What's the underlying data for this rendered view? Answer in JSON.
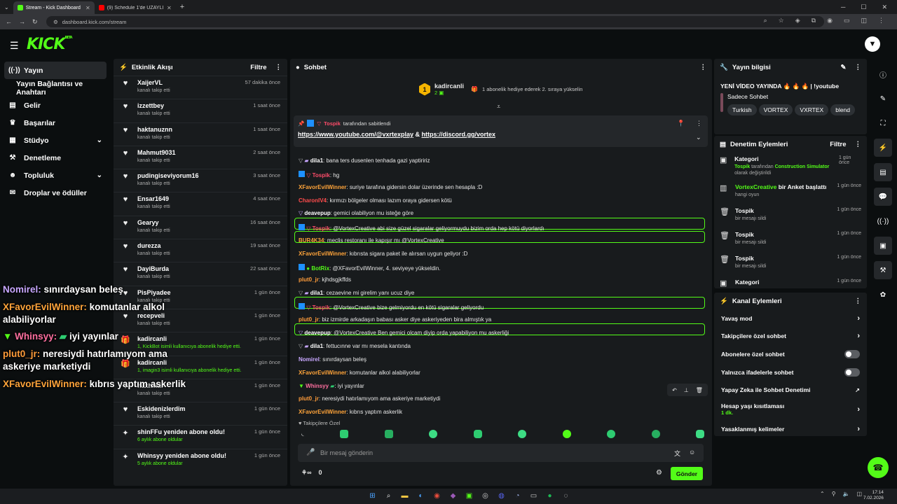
{
  "browser": {
    "tabs": [
      {
        "title": "Stream - Kick Dashboard",
        "color": "#53fc18"
      },
      {
        "title": "(9) Schedule 1'de UZAYLI İSTİLA",
        "color": "#ff0000"
      }
    ],
    "new_tab": "+",
    "url": "dashboard.kick.com/stream"
  },
  "logo": {
    "text": "KICK",
    "badge": "BETA"
  },
  "sidebar": {
    "items": [
      {
        "label": "Yayın",
        "icon": "((·))"
      },
      {
        "label": "Yayın Bağlantısı ve Anahtarı",
        "icon": ""
      },
      {
        "label": "Gelir",
        "icon": "▤"
      },
      {
        "label": "Başarılar",
        "icon": "🏆"
      },
      {
        "label": "Stüdyo",
        "icon": "▦"
      },
      {
        "label": "Denetleme",
        "icon": "🔧"
      },
      {
        "label": "Topluluk",
        "icon": "👥"
      },
      {
        "label": "Droplar ve ödüller",
        "icon": "🎁"
      }
    ]
  },
  "overlay_chat": [
    {
      "user": "Nomirel:",
      "text": " sınırdaysan beleş",
      "color": "#c8a7ff"
    },
    {
      "user": "XFavorEvilWinner:",
      "text": " komutanlar alkol alabiliyorlar",
      "color": "#ffa43a"
    },
    {
      "user": "Whinsyy:",
      "text": " iyi yayınlar",
      "color": "#ff6fa0"
    },
    {
      "user": "plut0_jr:",
      "text": " neresiydi hatırlamıyom ama askeriye marketiydi",
      "color": "#ff9c3a"
    },
    {
      "user": "XFavorEvilWinner:",
      "text": " kıbrıs yaptım askerlik",
      "color": "#ffa43a"
    }
  ],
  "activity": {
    "title": "Etkinlik Akışı",
    "filter": "Filtre",
    "items": [
      {
        "name": "XaijerVL",
        "desc": "kanalı takip etti",
        "time": "57 dakika önce"
      },
      {
        "name": "izzettbey",
        "desc": "kanalı takip etti",
        "time": "1 saat önce"
      },
      {
        "name": "haktanuznn",
        "desc": "kanalı takip etti",
        "time": "1 saat önce"
      },
      {
        "name": "Mahmut9031",
        "desc": "kanalı takip etti",
        "time": "2 saat önce"
      },
      {
        "name": "pudingiseviyorum16",
        "desc": "kanalı takip etti",
        "time": "3 saat önce"
      },
      {
        "name": "Ensar1649",
        "desc": "kanalı takip etti",
        "time": "4 saat önce"
      },
      {
        "name": "Gearyy",
        "desc": "kanalı takip etti",
        "time": "16 saat önce"
      },
      {
        "name": "durezza",
        "desc": "kanalı takip etti",
        "time": "19 saat önce"
      },
      {
        "name": "DayiBurda",
        "desc": "kanalı takip etti",
        "time": "22 saat önce"
      },
      {
        "name": "PisPiyadee",
        "desc": "kanalı takip etti",
        "time": "1 gün önce"
      },
      {
        "name": "recepveli",
        "desc": "kanalı takip etti",
        "time": "1 gün önce"
      },
      {
        "name": "kadircanli",
        "desc": "1, KickBot isimli kullanıcıya abonelik hediye etti.",
        "time": "1 gün önce"
      },
      {
        "name": "kadircanli",
        "desc": "1, imagin3 isimli kullanıcıya abonelik hediye etti.",
        "time": "1 gün önce"
      },
      {
        "name": "haxhiktir",
        "desc": "kanalı takip etti",
        "time": "1 gün önce"
      },
      {
        "name": "Eskidenizlerdim",
        "desc": "kanalı takip etti",
        "time": "1 gün önce"
      },
      {
        "name": "shinFFu yeniden abone oldu!",
        "desc": "6 aylık abone oldular",
        "time": "1 gün önce"
      },
      {
        "name": "Whinsyy yeniden abone oldu!",
        "desc": "5 aylık abone oldular",
        "time": "1 gün önce"
      }
    ]
  },
  "chat": {
    "title": "Sohbet",
    "top_user": "kadircanli",
    "top_user_count": "2",
    "top_msg": "1 abonelik hediye ederek 2. sıraya yükselin",
    "pinned_by": "Tospik",
    "pinned_suffix": " tarafından sabitlendi",
    "pinned_link1": "https://www.youtube.com/@vxrtexplay",
    "pinned_amp": " & ",
    "pinned_link2": "https://discord.gg/vortex",
    "messages": [
      {
        "user": "dila1",
        "text": ": bana ters dusenlen tenhada gazi yaptiririz",
        "color": "#ffffff"
      },
      {
        "user": "Tospik",
        "text": ": hg",
        "color": "#ff4c6a"
      },
      {
        "user": "XFavorEvilWinner",
        "text": ": suriye tarafına gidersin dolar üzerinde sen hesapla :D",
        "color": "#ffa43a"
      },
      {
        "user": "CharonIV4",
        "text": ": kırmızı bölgeler olması lazım oraya gidersen kötü",
        "color": "#ff4c4c"
      },
      {
        "user": "deavepup",
        "text": ": gemici olabiliyon mu isteğe göre",
        "color": "#ffffff"
      },
      {
        "user": "Tospik",
        "text": ": @VortexCreative abi size güzel sigaralar geliyormuydu bizim orda hep kötü diyorlardı",
        "color": "#ff4c6a"
      },
      {
        "user": "BUR4K34",
        "text": ": meclis restoranı ile kapışır mı @VortexCreative",
        "color": "#ffa43a"
      },
      {
        "user": "XFavorEvilWinner",
        "text": ": kıbrısta sigara paket ile alırsan uygun geliyor :D",
        "color": "#ffa43a"
      },
      {
        "user": "BotRix",
        "text": ": @XFavorEvilWinner, 4. seviyeye yükseldin.",
        "color": "#53fc18"
      },
      {
        "user": "plut0_jr",
        "text": ": kjhdsgjkffds",
        "color": "#ff9c3a"
      },
      {
        "user": "dila1",
        "text": ": cezaevine mi girelim yanı ucuz diye",
        "color": "#ffffff"
      },
      {
        "user": "Tospik",
        "text": ": @VortexCreative bize gelmiyordu en kötü sigaralar geliyordu",
        "color": "#ff4c6a"
      },
      {
        "user": "plut0_jr",
        "text": ": biz izmirde arkadaşın babası asker diye askeriyeden bira almıştık ya",
        "color": "#ff9c3a"
      },
      {
        "user": "deavepup",
        "text": ": @VortexCreative Ben gemici olcam diyip orda yapabiliyon mu askerliği",
        "color": "#ffffff"
      },
      {
        "user": "dila1",
        "text": ": fettucınne var mı mesela kantında",
        "color": "#ffffff"
      },
      {
        "user": "Nomirel",
        "text": ": sınırdaysan beleş",
        "color": "#c8a7ff"
      },
      {
        "user": "XFavorEvilWinner",
        "text": ": komutanlar alkol alabiliyorlar",
        "color": "#ffa43a"
      },
      {
        "user": "Whinsyy",
        "text": ": iyi yayınlar",
        "color": "#ff6fa0"
      },
      {
        "user": "plut0_jr",
        "text": ": neresiydi hatırlamıyom ama askeriye marketiydi",
        "color": "#ff9c3a"
      },
      {
        "user": "XFavorEvilWinner",
        "text": ": kıbrıs yaptım askerlik",
        "color": "#ffa43a"
      }
    ],
    "followers_only": "Takipçilere Özel",
    "input_placeholder": "Bir mesaj gönderin",
    "points": "0",
    "send": "Gönder"
  },
  "stream_info": {
    "title": "Yayın bilgisi",
    "stream_title": "YENİ VİDEO YAYINDA 🔥 🔥 🔥 | !youtube",
    "category": "Sadece Sohbet",
    "tags": [
      "Turkish",
      "VORTEX",
      "VXRTEX",
      "blend"
    ]
  },
  "mod_actions": {
    "title": "Denetim Eylemleri",
    "filter": "Filtre",
    "items": [
      {
        "name": "Kategori",
        "desc_user": "Tospik",
        "desc_mid": " tarafından ",
        "desc_cat": "Construction Simulator",
        "desc_end": " olarak değiştirildi",
        "time": "1 gün önce"
      },
      {
        "name": "VortexCreative",
        "name_suffix": " bir Anket başlattı",
        "desc": "hangi oyun",
        "time": "1 gün önce"
      },
      {
        "name": "Tospik",
        "desc": "bir mesajı sildi",
        "time": "1 gün önce"
      },
      {
        "name": "Tospik",
        "desc": "bir mesajı sildi",
        "time": "1 gün önce"
      },
      {
        "name": "Tospik",
        "desc": "bir mesajı sildi",
        "time": "1 gün önce"
      },
      {
        "name": "Kategori",
        "desc": "",
        "time": "1 gün önce"
      }
    ]
  },
  "channel_actions": {
    "title": "Kanal Eylemleri",
    "items": [
      {
        "label": "Yavaş mod",
        "type": "chevron"
      },
      {
        "label": "Takipçilere özel sohbet",
        "type": "chevron"
      },
      {
        "label": "Abonelere özel sohbet",
        "type": "toggle"
      },
      {
        "label": "Yalnızca ifadelerle sohbet",
        "type": "toggle"
      },
      {
        "label": "Yapay Zeka ile Sohbet Denetimi",
        "type": "external"
      },
      {
        "label": "Hesap yaşı kısıtlaması",
        "sub": "1 dk.",
        "type": "chevron"
      },
      {
        "label": "Yasaklanmış kelimeler",
        "type": "chevron"
      }
    ]
  },
  "taskbar": {
    "time": "17:14",
    "date": "7.02.2026"
  },
  "colors": {
    "accent": "#53fc18",
    "panel": "#181b1d",
    "bg": "#0b0e0f"
  }
}
